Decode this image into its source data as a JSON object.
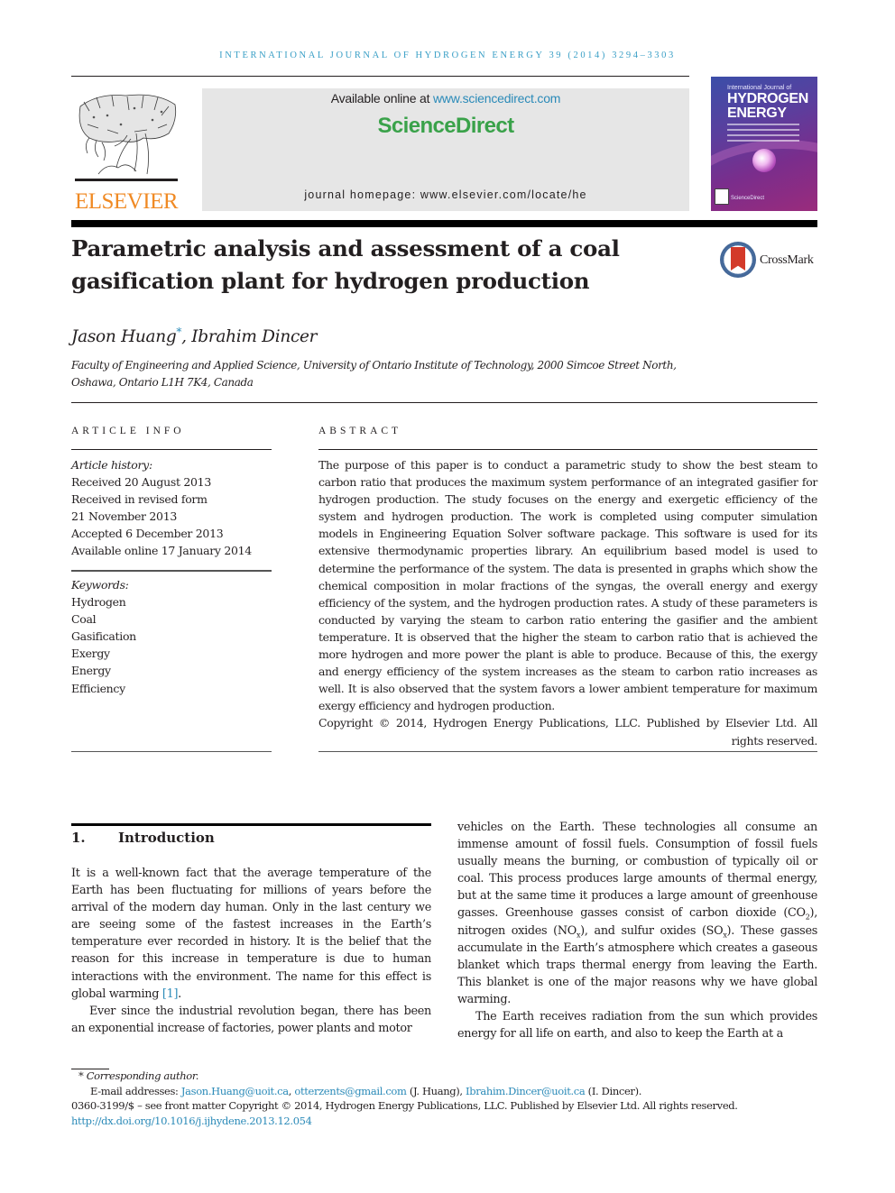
{
  "running_head": "INTERNATIONAL JOURNAL OF HYDROGEN ENERGY 39 (2014) 3294–3303",
  "publisher": {
    "logo_text": "ELSEVIER",
    "available_online_prefix": "Available online at ",
    "sciencedirect_url": "www.sciencedirect.com",
    "sciencedirect_logo": "ScienceDirect",
    "journal_homepage": "journal homepage: www.elsevier.com/locate/he",
    "brand_colors": {
      "elsevier_orange": "#f08a24",
      "sciencedirect_green": "#3aa24a",
      "link_blue": "#2a8ab8"
    }
  },
  "cover": {
    "sup_title": "International Journal of",
    "title_line1": "HYDROGEN",
    "title_line2": "ENERGY",
    "footer": "ScienceDirect"
  },
  "crossmark": {
    "label": "CrossMark"
  },
  "article": {
    "title": "Parametric analysis and assessment of a coal gasification plant for hydrogen production",
    "authors": [
      {
        "name": "Jason Huang",
        "mark": "*"
      },
      {
        "name": "Ibrahim Dincer"
      }
    ],
    "author_separator": ", ",
    "affiliation_line1": "Faculty of Engineering and Applied Science, University of Ontario Institute of Technology, 2000 Simcoe Street North,",
    "affiliation_line2": "Oshawa, Ontario L1H 7K4, Canada"
  },
  "article_info": {
    "heading": "ARTICLE INFO",
    "history_label": "Article history:",
    "history": [
      "Received 20 August 2013",
      "Received in revised form",
      "21 November 2013",
      "Accepted 6 December 2013",
      "Available online 17 January 2014"
    ],
    "keywords_label": "Keywords:",
    "keywords": [
      "Hydrogen",
      "Coal",
      "Gasification",
      "Exergy",
      "Energy",
      "Efficiency"
    ]
  },
  "abstract": {
    "heading": "ABSTRACT",
    "text": "The purpose of this paper is to conduct a parametric study to show the best steam to carbon ratio that produces the maximum system performance of an integrated gasifier for hydrogen production. The study focuses on the energy and exergetic efficiency of the system and hydrogen production. The work is completed using computer simulation models in Engineering Equation Solver software package. This software is used for its extensive thermodynamic properties library. An equilibrium based model is used to determine the performance of the system. The data is presented in graphs which show the chemical composition in molar fractions of the syngas, the overall energy and exergy efficiency of the system, and the hydrogen production rates. A study of these parameters is conducted by varying the steam to carbon ratio entering the gasifier and the ambient temperature. It is observed that the higher the steam to carbon ratio that is achieved the more hydrogen and more power the plant is able to produce. Because of this, the exergy and energy efficiency of the system increases as the steam to carbon ratio increases as well. It is also observed that the system favors a lower ambient temperature for maximum exergy efficiency and hydrogen production.",
    "copyright": "Copyright © 2014, Hydrogen Energy Publications, LLC. Published by Elsevier Ltd. All rights reserved."
  },
  "introduction": {
    "number": "1.",
    "title": "Introduction",
    "p1_text": "It is a well-known fact that the average temperature of the Earth has been fluctuating for millions of years before the arrival of the modern day human. Only in the last century we are seeing some of the fastest increases in the Earth’s temperature ever recorded in history. It is the belief that the reason for this increase in temperature is due to human interactions with the environment. The name for this effect is global warming ",
    "p1_ref": "[1]",
    "p1_end": ".",
    "p2_text": "Ever since the industrial revolution began, there has been an exponential increase of factories, power plants and motor",
    "p2_cont_a": "vehicles on the Earth. These technologies all consume an immense amount of fossil fuels. Consumption of fossil fuels usually means the burning, or combustion of typically oil or coal. This process produces large amounts of thermal energy, but at the same time it produces a large amount of greenhouse gasses. Greenhouse gasses consist of carbon dioxide (CO",
    "sub_2": "2",
    "p2_cont_b": "), nitrogen oxides (NO",
    "sub_x": "x",
    "p2_cont_c": "), and sulfur oxides (SO",
    "p2_cont_d": "). These gasses accumulate in the Earth’s atmosphere which creates a gaseous blanket which traps thermal energy from leaving the Earth. This blanket is one of the major reasons why we have global warming.",
    "p3_text": "The Earth receives radiation from the sun which provides energy for all life on earth, and also to keep the Earth at a"
  },
  "footnotes": {
    "corresponding_mark": "*",
    "corresponding_label": "Corresponding author.",
    "email_label": "E-mail addresses: ",
    "email1": "Jason.Huang@uoit.ca",
    "sep1": ", ",
    "email2": "otterzents@gmail.com",
    "email2_owner": " (J. Huang), ",
    "email3": "Ibrahim.Dincer@uoit.ca",
    "email3_owner": " (I. Dincer).",
    "issn_line": "0360-3199/$ – see front matter Copyright © 2014, Hydrogen Energy Publications, LLC. Published by Elsevier Ltd. All rights reserved.",
    "doi": "http://dx.doi.org/10.1016/j.ijhydene.2013.12.054"
  }
}
